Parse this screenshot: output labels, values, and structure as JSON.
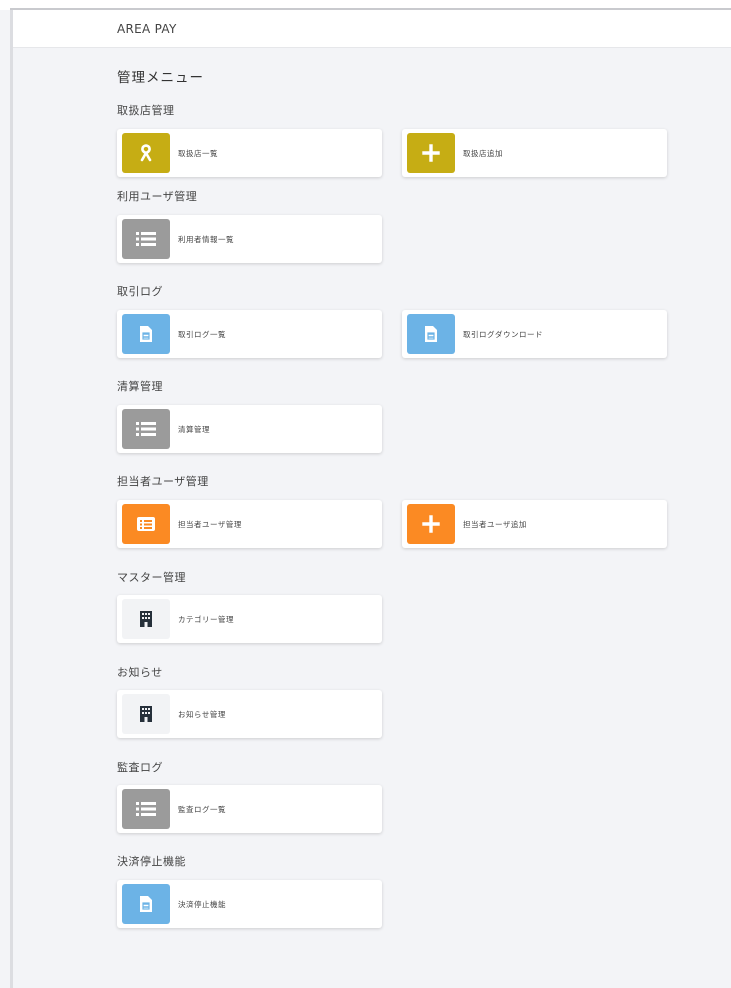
{
  "app": {
    "title": "AREA PAY"
  },
  "menu_title": "管理メニュー",
  "sections": [
    {
      "title": "取扱店管理",
      "cards": [
        {
          "label": "取扱店一覧",
          "icon": "ribbon-icon",
          "color": "#c6ad14"
        },
        {
          "label": "取扱店追加",
          "icon": "plus-icon",
          "color": "#c6ad14"
        }
      ]
    },
    {
      "title": "利用ユーザ管理",
      "cards": [
        {
          "label": "利用者情報一覧",
          "icon": "list-icon",
          "color": "#9b9b9b"
        }
      ]
    },
    {
      "title": "取引ログ",
      "cards": [
        {
          "label": "取引ログ一覧",
          "icon": "document-icon",
          "color": "#6cb3e6"
        },
        {
          "label": "取引ログダウンロード",
          "icon": "document-icon",
          "color": "#6cb3e6"
        }
      ]
    },
    {
      "title": "清算管理",
      "cards": [
        {
          "label": "清算管理",
          "icon": "list-icon",
          "color": "#9b9b9b"
        }
      ]
    },
    {
      "title": "担当者ユーザ管理",
      "cards": [
        {
          "label": "担当者ユーザ管理",
          "icon": "list-card-icon",
          "color": "#fb8a23"
        },
        {
          "label": "担当者ユーザ追加",
          "icon": "plus-icon",
          "color": "#fb8a23"
        }
      ]
    },
    {
      "title": "マスター管理",
      "cards": [
        {
          "label": "カテゴリー管理",
          "icon": "building-icon",
          "color": "#f2f3f5"
        }
      ]
    },
    {
      "title": "お知らせ",
      "cards": [
        {
          "label": "お知らせ管理",
          "icon": "building-icon",
          "color": "#f2f3f5"
        }
      ]
    },
    {
      "title": "監査ログ",
      "cards": [
        {
          "label": "監査ログ一覧",
          "icon": "list-icon",
          "color": "#9b9b9b"
        }
      ]
    },
    {
      "title": "決済停止機能",
      "cards": [
        {
          "label": "決済停止機能",
          "icon": "document-icon",
          "color": "#6cb3e6"
        }
      ]
    }
  ]
}
